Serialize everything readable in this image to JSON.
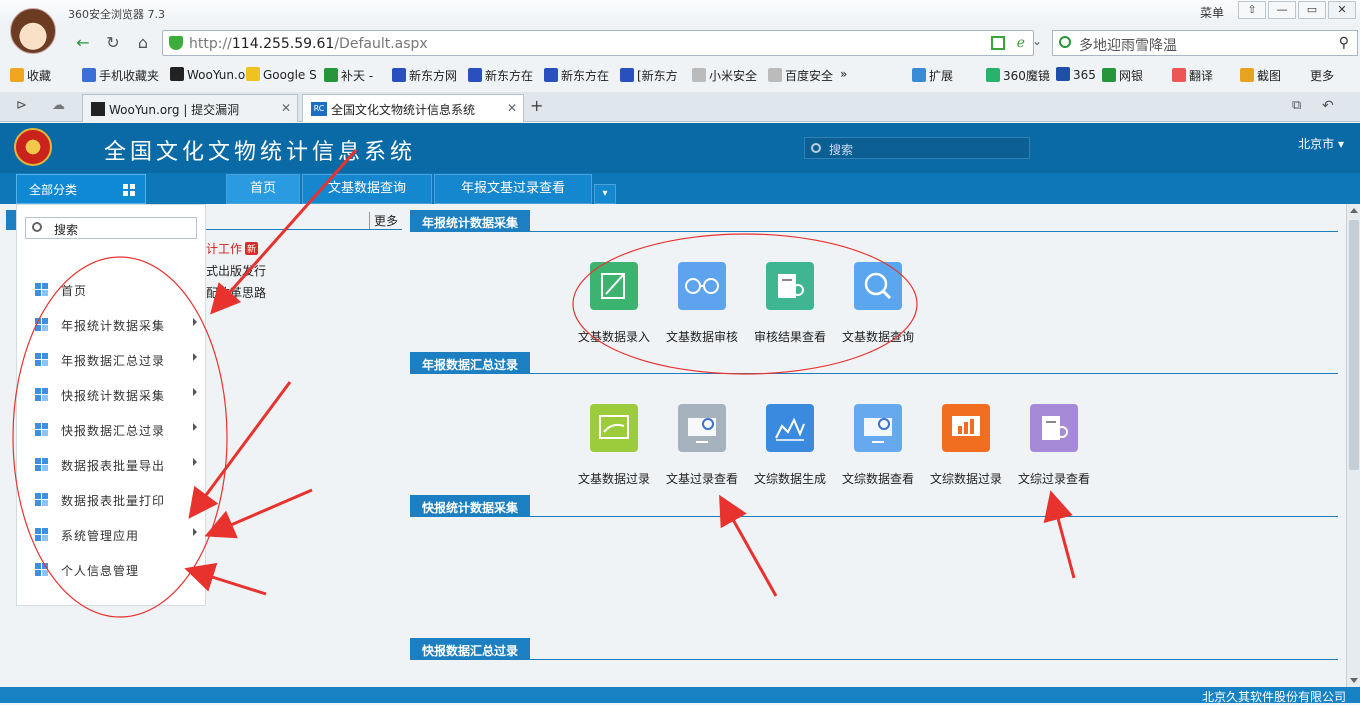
{
  "browser": {
    "title": "360安全浏览器 7.3",
    "menu_label": "菜单",
    "window_buttons": [
      "⇧",
      "—",
      "▭",
      "✕"
    ],
    "url_protocol": "http://",
    "url_host": "114.255.59.61",
    "url_path": "/Default.aspx",
    "search_placeholder": "多地迎雨雪降温",
    "bookmarks": [
      {
        "label": "收藏",
        "color": "#f0a71f"
      },
      {
        "label": "手机收藏夹",
        "color": "#3a6fd6"
      },
      {
        "label": "WooYun.o",
        "color": "#222222"
      },
      {
        "label": "Google S",
        "color": "#f0c21f"
      },
      {
        "label": "补天 -",
        "color": "#27963a"
      },
      {
        "label": "新东方网",
        "color": "#2a4fbf"
      },
      {
        "label": "新东方在",
        "color": "#2a4fbf"
      },
      {
        "label": "新东方在",
        "color": "#2a4fbf"
      },
      {
        "label": "[新东方",
        "color": "#2a4fbf"
      },
      {
        "label": "小米安全",
        "color": "#bbbbbb"
      },
      {
        "label": "百度安全",
        "color": "#bbbbbb"
      }
    ],
    "right_tools": [
      {
        "label": "扩展",
        "color": "#3a8bd6"
      },
      {
        "label": "360魔镜",
        "color": "#27b36b"
      },
      {
        "label": "365",
        "color": "#1f4fa8"
      },
      {
        "label": "网银",
        "color": "#27963a"
      },
      {
        "label": "翻译",
        "color": "#e55"
      },
      {
        "label": "截图",
        "color": "#e7a21f"
      },
      {
        "label": "更多",
        "color": "#ffffff"
      }
    ],
    "tabs": [
      {
        "label": "WooYun.org | 提交漏洞"
      },
      {
        "label": "全国文化文物统计信息系统"
      }
    ]
  },
  "app": {
    "title": "全国文化文物统计信息系统",
    "search_label": "搜索",
    "city": "北京市",
    "all_categories": "全部分类",
    "nav_tabs": [
      "首页",
      "文基数据查询",
      "年报文基过录查看"
    ],
    "sidebar": {
      "search_label": "搜索",
      "items": [
        {
          "label": "首页",
          "arrow": false
        },
        {
          "label": "年报统计数据采集",
          "arrow": true
        },
        {
          "label": "年报数据汇总过录",
          "arrow": true
        },
        {
          "label": "快报统计数据采集",
          "arrow": true
        },
        {
          "label": "快报数据汇总过录",
          "arrow": true
        },
        {
          "label": "数据报表批量导出",
          "arrow": true
        },
        {
          "label": "数据报表批量打印",
          "arrow": true
        },
        {
          "label": "系统管理应用",
          "arrow": true
        },
        {
          "label": "个人信息管理",
          "arrow": false
        }
      ]
    },
    "news": {
      "more_label": "更多",
      "items": [
        {
          "text": "计工作",
          "new_badge": "新"
        },
        {
          "text": "式出版发行"
        },
        {
          "text": "配改革思路"
        }
      ]
    },
    "sections": [
      {
        "title": "年报统计数据采集",
        "tiles": [
          {
            "label": "文基数据录入",
            "color": "#3db370",
            "icon": "edit-icon"
          },
          {
            "label": "文基数据审核",
            "color": "#5ea3ee",
            "icon": "glasses-icon"
          },
          {
            "label": "审核结果查看",
            "color": "#3fb592",
            "icon": "doc-search-icon"
          },
          {
            "label": "文基数据查询",
            "color": "#5aa7f0",
            "icon": "magnifier-icon"
          }
        ]
      },
      {
        "title": "年报数据汇总过录",
        "tiles": [
          {
            "label": "文基数据过录",
            "color": "#9ccb3b",
            "icon": "chart-screen-icon"
          },
          {
            "label": "文基过录查看",
            "color": "#a6b2bd",
            "icon": "monitor-search-icon"
          },
          {
            "label": "文综数据生成",
            "color": "#3a8be0",
            "icon": "line-chart-icon"
          },
          {
            "label": "文综数据查看",
            "color": "#67a9ee",
            "icon": "monitor-search-icon"
          },
          {
            "label": "文综数据过录",
            "color": "#f16d1f",
            "icon": "bar-screen-icon"
          },
          {
            "label": "文综过录查看",
            "color": "#a68ad8",
            "icon": "doc-search-icon"
          }
        ]
      },
      {
        "title": "快报统计数据采集",
        "tiles": []
      },
      {
        "title": "快报数据汇总过录",
        "tiles": []
      }
    ],
    "footer": "北京久其软件股份有限公司"
  }
}
